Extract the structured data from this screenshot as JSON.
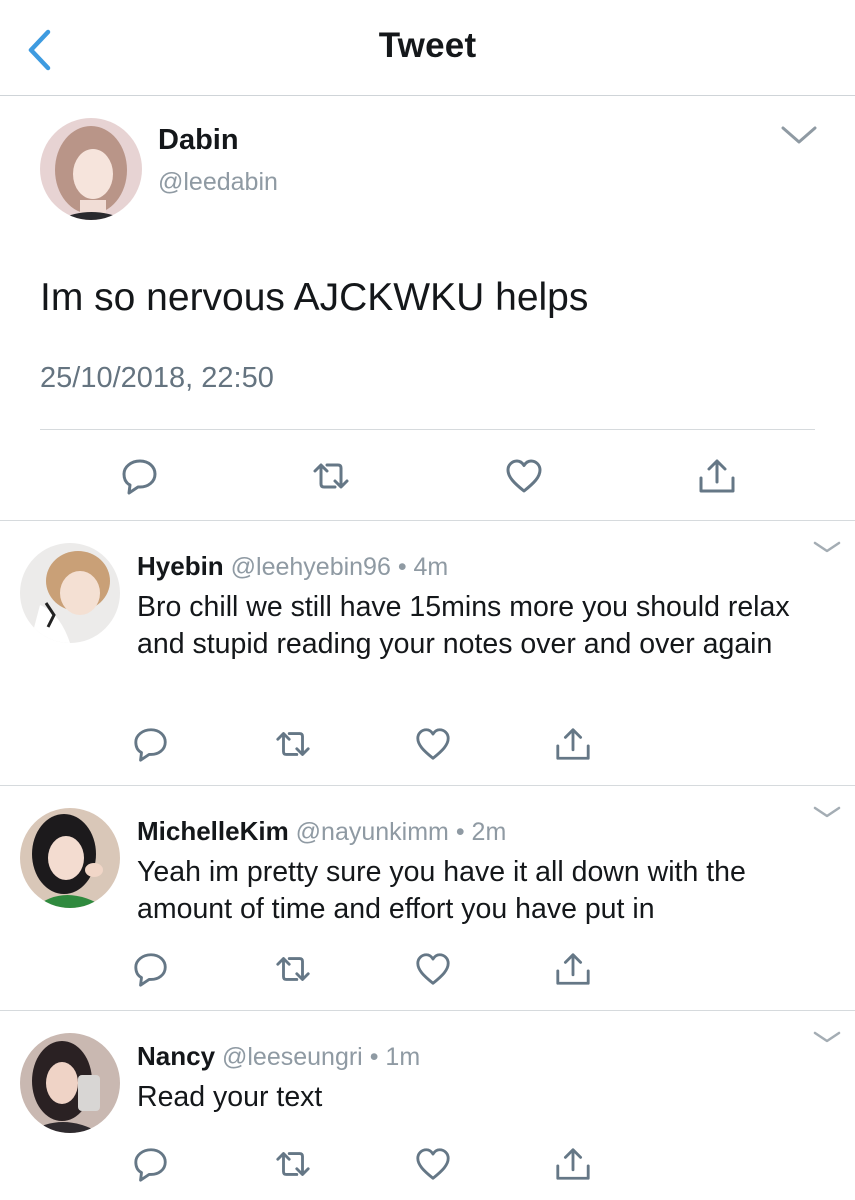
{
  "header": {
    "title": "Tweet",
    "back_icon": "chevron-left-icon",
    "accent": "#1da1f2"
  },
  "main_tweet": {
    "name": "Dabin",
    "handle": "@leedabin",
    "text": "Im so nervous AJCKWKU helps",
    "timestamp": "25/10/2018, 22:50",
    "actions": [
      "reply-icon",
      "retweet-icon",
      "like-icon",
      "share-icon"
    ]
  },
  "replies": [
    {
      "name": "Hyebin",
      "handle": "@leehyebin96",
      "dot": "•",
      "time": "4m",
      "text": "Bro chill we still have 15mins more you should relax and stupid reading your notes over and over again"
    },
    {
      "name": "MichelleKim",
      "handle": "@nayunkimm",
      "dot": "•",
      "time": "2m",
      "text": "Yeah im pretty sure you have it all down with the amount of time and effort you have put in"
    },
    {
      "name": "Nancy",
      "handle": "@leeseungri",
      "dot": "•",
      "time": "1m",
      "text": "Read your text"
    }
  ],
  "colors": {
    "icon": "#657786",
    "text_secondary": "#8f9aa3",
    "divider": "#d6dadd"
  }
}
